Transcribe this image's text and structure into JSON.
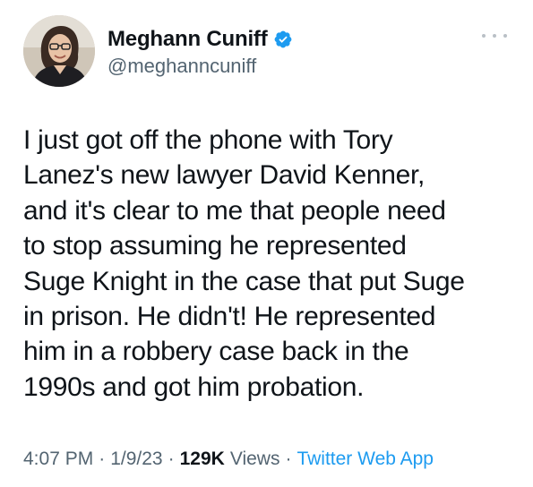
{
  "author": {
    "display_name": "Meghann Cuniff",
    "handle": "@meghanncuniff",
    "verified": true,
    "verified_color": "#1d9bf0",
    "avatar_icon": "profile-photo"
  },
  "tweet": {
    "lines": [
      "I just got off the phone with Tory",
      "Lanez's new lawyer David Kenner,",
      "and it's clear to me that people need",
      "to stop assuming he represented",
      "Suge Knight in the case that put Suge",
      "in prison. He didn't! He represented",
      "him in a robbery case back in the",
      "1990s and got him probation."
    ]
  },
  "meta": {
    "time": "4:07 PM",
    "date": "1/9/23",
    "views_count": "129K",
    "views_label": "Views",
    "source": "Twitter Web App",
    "separator": "·"
  },
  "colors": {
    "text": "#0f1419",
    "secondary": "#536471",
    "link": "#1d9bf0"
  },
  "icons": {
    "more": "more-dots-icon",
    "verified": "verified-badge-icon"
  }
}
